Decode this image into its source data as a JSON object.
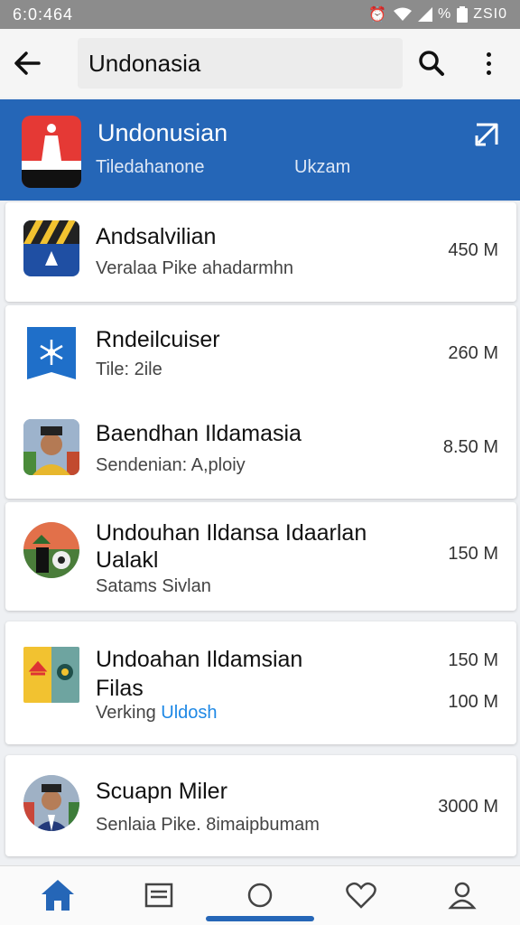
{
  "status_bar": {
    "time": "6:0:464",
    "right_text": "ZSI0"
  },
  "app_bar": {
    "title": "Undonasia"
  },
  "banner": {
    "name": "Undonusian",
    "subtitle": "Tiledahanone",
    "subtitle2": "Ukzam"
  },
  "items": [
    {
      "title": "Andsalvilian",
      "desc": "Veralaa Pike ahadarmhn",
      "size": "450 M"
    },
    {
      "title": "Rndeilcuiser",
      "desc": "Tile: 2ile",
      "size": "260 M"
    },
    {
      "title": "Baendhan Ildamasia",
      "desc": "Sendenian: A,ploiy",
      "size": "8.50 M"
    },
    {
      "title": "Undouhan Ildansa Idaarlan",
      "title2": "Ualakl",
      "desc": "Satams Sivlan",
      "size": "150 M"
    },
    {
      "title": "Undoahan Ildamsian",
      "title2": "Filas",
      "desc": "Verking",
      "desc_link": "Uldosh",
      "size": "150 M",
      "size2": "100 M"
    },
    {
      "title": "Scuapn Miler",
      "desc": "Senlaia Pike. 8imaipbumam",
      "size": "3000 M"
    }
  ],
  "colors": {
    "primary": "#2566b7",
    "accent_red": "#e53935",
    "link": "#1e88e5"
  },
  "icons": [
    "back-arrow-icon",
    "search-icon",
    "more-vert-icon",
    "home-icon",
    "list-icon",
    "circle-icon",
    "heart-icon",
    "person-icon"
  ]
}
